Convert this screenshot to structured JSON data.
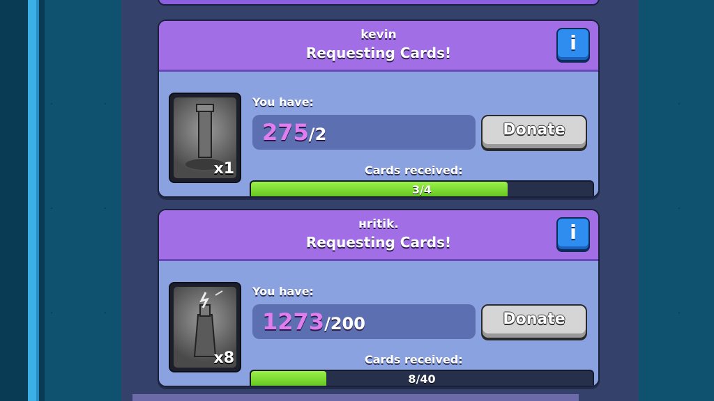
{
  "requests": [
    {
      "player": "kevin",
      "status": "Requesting Cards!",
      "info_label": "i",
      "you_have_label": "You have:",
      "owned": "275",
      "needed": "/2",
      "card_count": "x1",
      "card_icon": "tombstone-card-icon",
      "donate_label": "Donate",
      "received_label": "Cards received:",
      "progress_text": "3/4",
      "progress_fraction": 0.75
    },
    {
      "player": "нritik.",
      "status": "Requesting Cards!",
      "info_label": "i",
      "you_have_label": "You have:",
      "owned": "1273",
      "needed": "/200",
      "card_count": "x8",
      "card_icon": "tesla-card-icon",
      "donate_label": "Donate",
      "received_label": "Cards received:",
      "progress_text": "8/40",
      "progress_fraction": 0.2
    }
  ]
}
